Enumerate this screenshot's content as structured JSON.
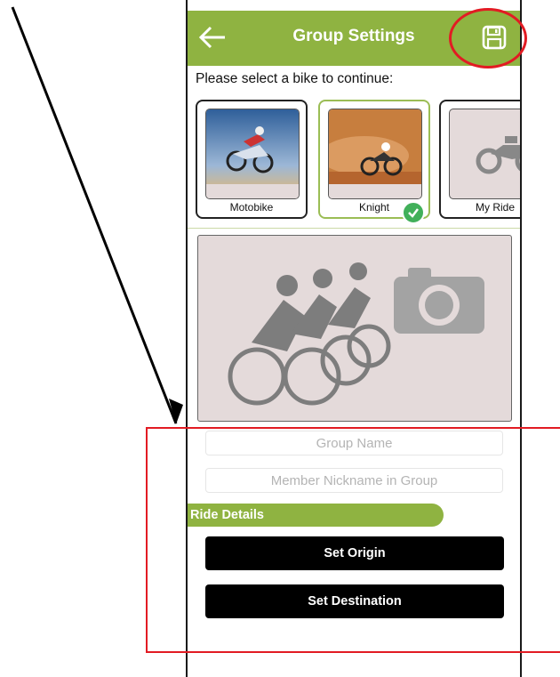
{
  "header": {
    "title": "Group Settings",
    "back_icon": "arrow-left-icon",
    "save_icon": "floppy-disk-icon",
    "color": "#8fb341"
  },
  "prompt": "Please select a bike to continue:",
  "bikes": [
    {
      "label": "Motobike",
      "selected": false
    },
    {
      "label": "Knight",
      "selected": true
    },
    {
      "label": "My Ride",
      "selected": false
    }
  ],
  "form": {
    "group_name_placeholder": "Group Name",
    "nickname_placeholder": "Member Nickname in Group"
  },
  "ride_details": {
    "section_title": "Ride Details",
    "origin_button": "Set Origin",
    "destination_button": "Set Destination"
  },
  "annotation_color": "#e21b23"
}
